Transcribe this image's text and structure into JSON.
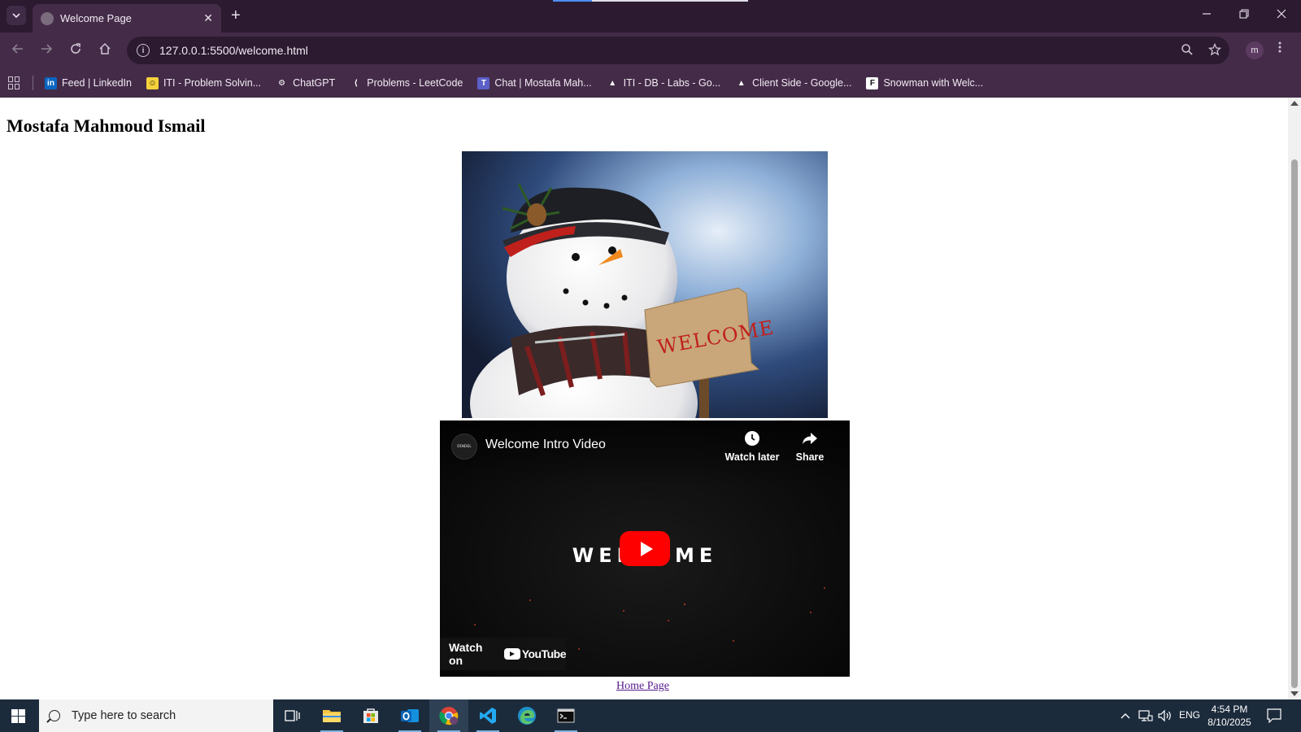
{
  "browser": {
    "tab_title": "Welcome Page",
    "tab_close": "✕",
    "new_tab": "+",
    "url": "127.0.0.1:5500/welcome.html",
    "profile_initial": "m",
    "bookmarks": [
      {
        "label": "Feed | LinkedIn",
        "icon": "linkedin-icon",
        "color": "#0a66c2",
        "glyph": "in"
      },
      {
        "label": "ITI - Problem Solvin...",
        "icon": "iti-icon",
        "color": "#f5d23a",
        "glyph": "☺"
      },
      {
        "label": "ChatGPT",
        "icon": "chatgpt-icon",
        "color": "#442c49",
        "glyph": "⚙"
      },
      {
        "label": "Problems - LeetCode",
        "icon": "leetcode-icon",
        "color": "#442c49",
        "glyph": "⟨"
      },
      {
        "label": "Chat | Mostafa Mah...",
        "icon": "teams-icon",
        "color": "#5b5fc7",
        "glyph": "T"
      },
      {
        "label": "ITI - DB - Labs - Go...",
        "icon": "google-drive-icon",
        "color": "#442c49",
        "glyph": "▲"
      },
      {
        "label": "Client Side - Google...",
        "icon": "google-drive-icon",
        "color": "#442c49",
        "glyph": "▲"
      },
      {
        "label": "Snowman with Welc...",
        "icon": "freepik-icon",
        "color": "#ffffff",
        "glyph": "F"
      }
    ]
  },
  "page": {
    "heading": "Mostafa Mahmoud Ismail",
    "image_sign_text": "WELCOME",
    "video": {
      "title": "Welcome Intro Video",
      "channel_avatar_text": "ᴅɪɴᴅᴇʟ",
      "watch_later": "Watch later",
      "share": "Share",
      "overlay_text": "WELCOME",
      "watch_on": "Watch on",
      "youtube_word": "YouTube"
    },
    "home_link": "Home Page"
  },
  "taskbar": {
    "search_placeholder": "Type here to search",
    "language": "ENG",
    "time": "4:54 PM",
    "date": "8/10/2025"
  },
  "colors": {
    "chrome_dark": "#2b1a30",
    "chrome_mid": "#442c49",
    "youtube_red": "#ff0000",
    "visited_link": "#551a8b",
    "taskbar": "#1c2b3c"
  }
}
